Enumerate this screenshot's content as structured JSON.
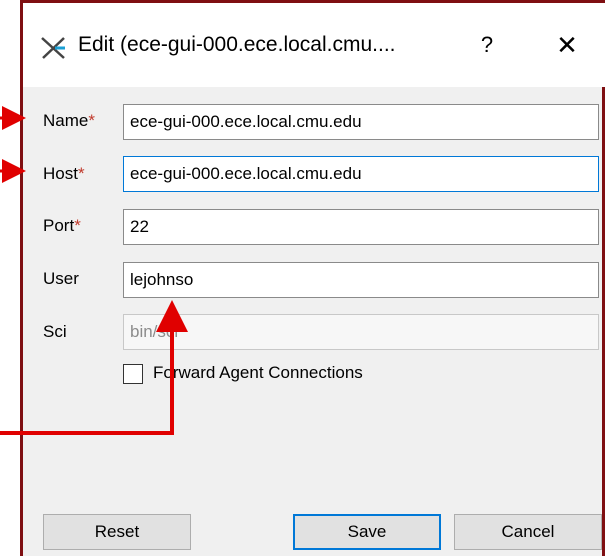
{
  "window": {
    "title": "Edit (ece-gui-000.ece.local.cmu....",
    "app_icon": "x-cross-icon",
    "help_label": "?",
    "close_label": "✕"
  },
  "form": {
    "name": {
      "label": "Name",
      "required_mark": "*",
      "value": "ece-gui-000.ece.local.cmu.edu"
    },
    "host": {
      "label": "Host",
      "required_mark": "*",
      "value": "ece-gui-000.ece.local.cmu.edu"
    },
    "port": {
      "label": "Port",
      "required_mark": "*",
      "value": "22"
    },
    "user": {
      "label": "User",
      "value": "lejohnso"
    },
    "sci": {
      "label": "Sci",
      "placeholder": "bin/sci"
    },
    "forward_agent": {
      "label": "Forward Agent Connections",
      "checked": false
    }
  },
  "buttons": {
    "reset": "Reset",
    "save": "Save",
    "cancel": "Cancel"
  },
  "colors": {
    "frame_border": "#7f0f12",
    "annotation_arrow": "#e00000",
    "focus_blue": "#0078d7",
    "required_star": "#c0392b"
  }
}
